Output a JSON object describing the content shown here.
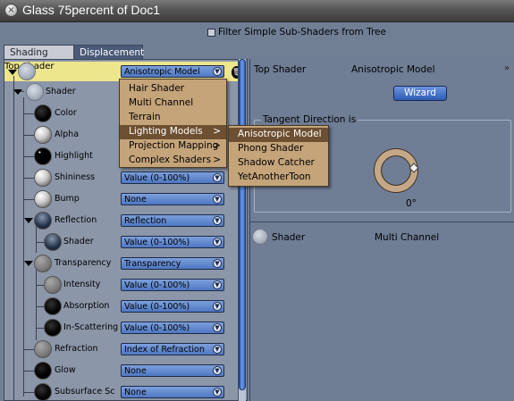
{
  "window": {
    "title": "Glass 75percent of Doc1",
    "close_glyph": "×"
  },
  "filter": {
    "label": "Filter Simple Sub-Shaders from Tree",
    "checked": false
  },
  "tabs": [
    {
      "label": "Shading",
      "active": true
    },
    {
      "label": "Displacement",
      "active": false
    }
  ],
  "tree": {
    "top": {
      "label": "Top Shader",
      "value": "Anisotropic Model"
    },
    "rows": [
      {
        "label": "Shader",
        "value": ""
      },
      {
        "label": "Color",
        "value": ""
      },
      {
        "label": "Alpha",
        "value": ""
      },
      {
        "label": "Highlight",
        "value": ""
      },
      {
        "label": "Shininess",
        "value": "Value (0-100%)"
      },
      {
        "label": "Bump",
        "value": "None"
      },
      {
        "label": "Reflection",
        "value": "Reflection"
      },
      {
        "label": "Shader",
        "value": "Value (0-100%)"
      },
      {
        "label": "Transparency",
        "value": "Transparency"
      },
      {
        "label": "Intensity",
        "value": "Value (0-100%)"
      },
      {
        "label": "Absorption",
        "value": "Value (0-100%)"
      },
      {
        "label": "In-Scattering",
        "value": "Value (0-100%)"
      },
      {
        "label": "Refraction",
        "value": "Index of Refraction"
      },
      {
        "label": "Glow",
        "value": "None"
      },
      {
        "label": "Subsurface Sc",
        "value": "None"
      }
    ]
  },
  "menu_main": {
    "items": [
      {
        "label": "Hair Shader",
        "submenu": ""
      },
      {
        "label": "Multi Channel",
        "submenu": ""
      },
      {
        "label": "Terrain",
        "submenu": ""
      },
      {
        "label": "Lighting Models",
        "submenu": ">"
      },
      {
        "label": "Projection Mapping",
        "submenu": ">"
      },
      {
        "label": "Complex Shaders",
        "submenu": ">"
      }
    ],
    "highlighted_index": 3
  },
  "menu_sub": {
    "items": [
      "Anisotropic Model",
      "Phong Shader",
      "Shadow Catcher",
      "YetAnotherToon"
    ],
    "highlighted_index": 0
  },
  "right_panel": {
    "top_label": "Top Shader",
    "top_value": "Anisotropic Model",
    "collapse_glyph": "»",
    "wizard_label": "Wizard",
    "tangent_title": "Tangent Direction is",
    "tangent_value": "0°",
    "shader_label": "Shader",
    "shader_value": "Multi Channel"
  },
  "colors": {
    "background": "#717f95",
    "top_row_highlight": "#ede68c",
    "dropdown_blue": "#5b82c9",
    "menu_bg": "#c5a47a",
    "menu_highlight": "#6d4f31"
  }
}
